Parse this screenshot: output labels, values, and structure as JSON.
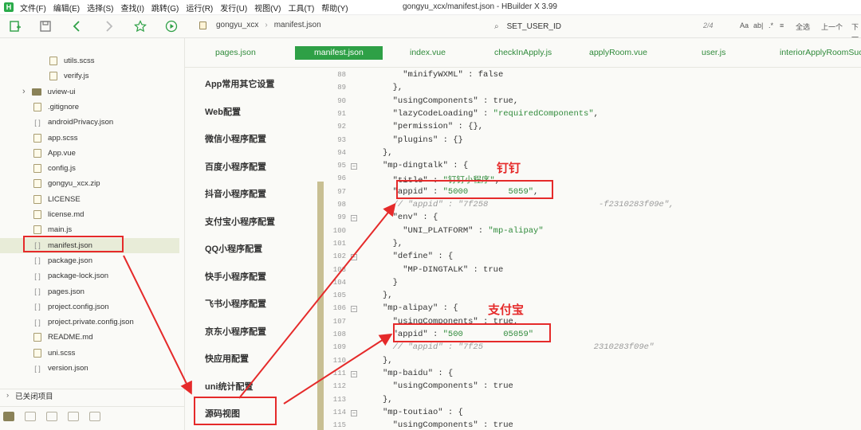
{
  "menu": {
    "items": [
      "文件(F)",
      "编辑(E)",
      "选择(S)",
      "查找(I)",
      "跳转(G)",
      "运行(R)",
      "发行(U)",
      "视图(V)",
      "工具(T)",
      "帮助(Y)"
    ],
    "window_title": "gongyu_xcx/manifest.json - HBuilder X 3.99"
  },
  "toolbar": {
    "breadcrumb": [
      "gongyu_xcx",
      "manifest.json"
    ],
    "search_value": "SET_USER_ID",
    "match_count": "2/4",
    "options": [
      "Aa",
      "ab|",
      ".*",
      "全选",
      "上一个",
      "下一"
    ]
  },
  "sidebar": {
    "items": [
      {
        "label": "utils.scss",
        "icon": "scss-icon",
        "indent": 2
      },
      {
        "label": "verify.js",
        "icon": "js-file-icon",
        "indent": 2
      },
      {
        "label": "uview-ui",
        "icon": "folder-icon",
        "indent": 1,
        "folder": true
      },
      {
        "label": ".gitignore",
        "icon": "file-icon",
        "indent": 1
      },
      {
        "label": "androidPrivacy.json",
        "icon": "json-icon",
        "indent": 1
      },
      {
        "label": "app.scss",
        "icon": "scss-icon",
        "indent": 1
      },
      {
        "label": "App.vue",
        "icon": "vue-file-icon",
        "indent": 1
      },
      {
        "label": "config.js",
        "icon": "js-file-icon",
        "indent": 1
      },
      {
        "label": "gongyu_xcx.zip",
        "icon": "file-icon",
        "indent": 1
      },
      {
        "label": "LICENSE",
        "icon": "file-icon",
        "indent": 1
      },
      {
        "label": "license.md",
        "icon": "markdown-icon",
        "indent": 1
      },
      {
        "label": "main.js",
        "icon": "js-file-icon",
        "indent": 1
      },
      {
        "label": "manifest.json",
        "icon": "json-icon",
        "indent": 1,
        "selected": true
      },
      {
        "label": "package.json",
        "icon": "json-icon",
        "indent": 1
      },
      {
        "label": "package-lock.json",
        "icon": "json-icon",
        "indent": 1
      },
      {
        "label": "pages.json",
        "icon": "json-icon",
        "indent": 1
      },
      {
        "label": "project.config.json",
        "icon": "json-icon",
        "indent": 1
      },
      {
        "label": "project.private.config.json",
        "icon": "json-icon",
        "indent": 1
      },
      {
        "label": "README.md",
        "icon": "markdown-icon",
        "indent": 1
      },
      {
        "label": "uni.scss",
        "icon": "scss-icon",
        "indent": 1
      },
      {
        "label": "version.json",
        "icon": "json-icon",
        "indent": 1
      }
    ],
    "closed_projects": "已关闭项目"
  },
  "tabs": [
    {
      "label": "pages.json",
      "active": false
    },
    {
      "label": "manifest.json",
      "active": true
    },
    {
      "label": "index.vue",
      "active": false
    },
    {
      "label": "checkInApply.js",
      "active": false
    },
    {
      "label": "applyRoom.vue",
      "active": false
    },
    {
      "label": "user.js",
      "active": false
    },
    {
      "label": "interiorApplyRoomSuc",
      "active": false
    }
  ],
  "settings_nav": [
    "App常用其它设置",
    "Web配置",
    "微信小程序配置",
    "百度小程序配置",
    "抖音小程序配置",
    "支付宝小程序配置",
    "QQ小程序配置",
    "快手小程序配置",
    "飞书小程序配置",
    "京东小程序配置",
    "快应用配置",
    "uni统计配置",
    "源码视图"
  ],
  "code_lines": [
    {
      "n": "88",
      "text": "    \"minifyWXML\" : false"
    },
    {
      "n": "89",
      "text": "  },"
    },
    {
      "n": "90",
      "text": "  \"usingComponents\" : true,"
    },
    {
      "n": "91",
      "text": "  \"lazyCodeLoading\" : \"requiredComponents\","
    },
    {
      "n": "92",
      "text": "  \"permission\" : {},"
    },
    {
      "n": "93",
      "text": "  \"plugins\" : {}"
    },
    {
      "n": "94",
      "text": "},"
    },
    {
      "n": "95",
      "text": "\"mp-dingtalk\" : {",
      "fold": true
    },
    {
      "n": "96",
      "text": "  \"title\" : \"钉钉小程序\","
    },
    {
      "n": "97",
      "text": "  \"appid\" : \"5000        5059\",",
      "masked": true
    },
    {
      "n": "98",
      "text": "  // \"appid\" : \"7f258                      -f2310283f09e\",",
      "comment": true
    },
    {
      "n": "99",
      "text": "  \"env\" : {",
      "fold": true
    },
    {
      "n": "100",
      "text": "    \"UNI_PLATFORM\" : \"mp-alipay\""
    },
    {
      "n": "101",
      "text": "  },"
    },
    {
      "n": "102",
      "text": "  \"define\" : {",
      "fold": true
    },
    {
      "n": "103",
      "text": "    \"MP-DINGTALK\" : true"
    },
    {
      "n": "104",
      "text": "  }"
    },
    {
      "n": "105",
      "text": "},"
    },
    {
      "n": "106",
      "text": "\"mp-alipay\" : {",
      "fold": true
    },
    {
      "n": "107",
      "text": "  \"usingComponents\" : true,"
    },
    {
      "n": "108",
      "text": "  \"appid\" : \"500        05059\"",
      "masked": true
    },
    {
      "n": "109",
      "text": "  // \"appid\" : \"7f25                      2310283f09e\"",
      "comment": true
    },
    {
      "n": "110",
      "text": "},"
    },
    {
      "n": "111",
      "text": "\"mp-baidu\" : {",
      "fold": true
    },
    {
      "n": "112",
      "text": "  \"usingComponents\" : true"
    },
    {
      "n": "113",
      "text": "},"
    },
    {
      "n": "114",
      "text": "\"mp-toutiao\" : {",
      "fold": true
    },
    {
      "n": "115",
      "text": "  \"usingComponents\" : true"
    }
  ],
  "annotations": {
    "dingtalk_label": "钉钉",
    "alipay_label": "支付宝",
    "color": "#e52a2a"
  },
  "colors": {
    "accent": "#2ea046",
    "string": "#2f8a3a"
  }
}
